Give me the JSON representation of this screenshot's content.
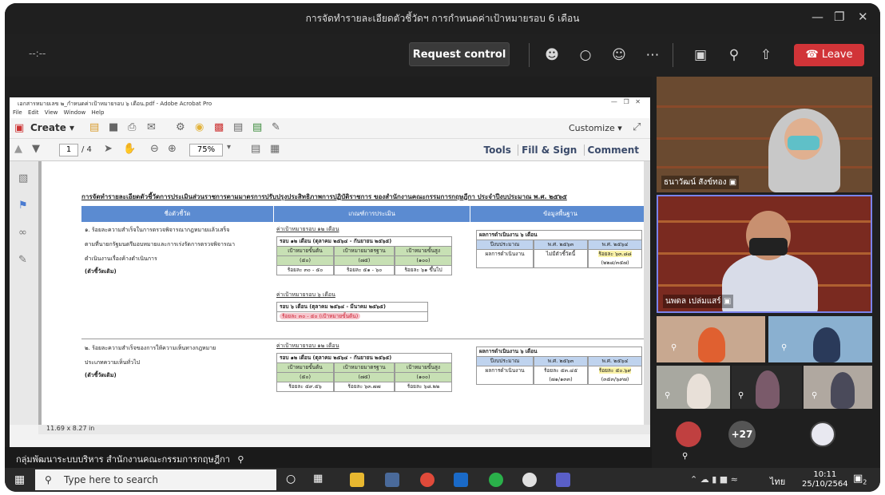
{
  "meeting": {
    "title": "การจัดทำรายละเอียดตัวชี้วัดฯ การกำหนดค่าเป้าหมายรอบ 6 เดือน",
    "timer": "--:--",
    "request_control": "Request control",
    "leave": "Leave"
  },
  "acrobat": {
    "file_title": "เอกสารหมายเลข ๒_กำหนดค่าเป้าหมายรอบ ๖ เดือน.pdf - Adobe Acrobat Pro",
    "menu": [
      "File",
      "Edit",
      "View",
      "Window",
      "Help"
    ],
    "create": "Create",
    "customize": "Customize",
    "page_current": "1",
    "page_total": "/ 4",
    "zoom": "75%",
    "tools": "Tools",
    "fill_sign": "Fill & Sign",
    "comment": "Comment",
    "page_size": "11.69 x 8.27 in"
  },
  "document": {
    "title": "การจัดทำรายละเอียดตัวชี้วัดการประเมินส่วนราชการตามมาตรการปรับปรุงประสิทธิภาพการปฏิบัติราชการ ของสำนักงานคณะกรรมการกฤษฎีกา ประจำปีงบประมาณ พ.ศ. ๒๕๖๕",
    "col_indicator": "ชื่อตัวชี้วัด",
    "col_criteria": "เกณฑ์การประเมิน",
    "col_baseline": "ข้อมูลพื้นฐาน",
    "ind1_line1": "๑. ร้อยละความสำเร็จในการตรวจพิจารณากฎหมายแล้วเสร็จ",
    "ind1_line2": "ตามที่นายกรัฐมนตรีมอบหมายและการเร่งรัดการตรวจพิจารณา",
    "ind1_line3": "ดำเนินงานเรื่องค้างดำเนินการ",
    "ind1_note": "(ตัวชี้วัดเดิม)",
    "target12": "ค่าเป้าหมายรอบ ๑๒ เดือน",
    "round12": "รอบ ๑๒ เดือน (ตุลาคม ๒๕๖๔ - กันยายน ๒๕๖๕)",
    "min_label": "เป้าหมายขั้นต้น",
    "std_label": "เป้าหมายมาตรฐาน",
    "max_label": "เป้าหมายขั้นสูง",
    "min_score": "(๕๐)",
    "std_score": "(๗๕)",
    "max_score": "(๑๐๐)",
    "ind1_min": "ร้อยละ ๓๐ - ๕๐",
    "ind1_std": "ร้อยละ ๕๑ - ๖๐",
    "ind1_max": "ร้อยละ ๖๑ ขึ้นไป",
    "target6": "ค่าเป้าหมายรอบ ๖ เดือน",
    "round6": "รอบ ๖ เดือน (ตุลาคม ๒๕๖๔ - มีนาคม ๒๕๖๕)",
    "round6_value": "ร้อยละ ๓๐ - ๕๐ (เป้าหมายขั้นต้น)",
    "result6": "ผลการดำเนินงาน ๖ เดือน",
    "fiscal": "ปีงบประมาณ",
    "y63": "พ.ศ. ๒๕๖๓",
    "y64": "พ.ศ. ๒๕๖๔",
    "performance": "ผลการดำเนินงาน",
    "ind1_y63": "ไม่มีตัวชี้วัดนี้",
    "ind1_y64": "ร้อยละ ๖๓.๘๘",
    "ind1_y64_sub": "(๒๒๘/๓๕๗)",
    "ind2_line1": "๒. ร้อยละความสำเร็จของการให้ความเห็นทางกฎหมาย",
    "ind2_line2": "ประเภทความเห็นทั่วไป",
    "ind2_note": "(ตัวชี้วัดเดิม)",
    "ind2_min": "ร้อยละ ๕๙.๕๖",
    "ind2_std": "ร้อยละ ๖๓.๗๗",
    "ind2_max": "ร้อยละ ๖๘.๒๒",
    "ind2_y63": "ร้อยละ ๕๓.๔๕",
    "ind2_y63_sub": "(๗๑/๑๓๓)",
    "ind2_y64": "ร้อยละ ๕๐.๖๙",
    "ind2_y64_sub": "(๓๕๓/๖๙๗)"
  },
  "caption": "กลุ่มพัฒนาระบบบริหาร สำนักงานคณะกรรมการกฤษฎีกา",
  "participants": {
    "p1": "ธนาวัฒน์ สังข์ทอง",
    "p2": "นพดล เปล่มแสร์",
    "overflow": "+27"
  },
  "taskbar": {
    "search": "Type here to search",
    "lang": "ไทย",
    "time": "10:11",
    "date": "25/10/2564",
    "notif": "2"
  },
  "colors": {
    "leave": "#d13438",
    "table_header": "#5b8bd1",
    "green_cell": "#c7e0b4",
    "blue_cell": "#bfd3ee"
  }
}
